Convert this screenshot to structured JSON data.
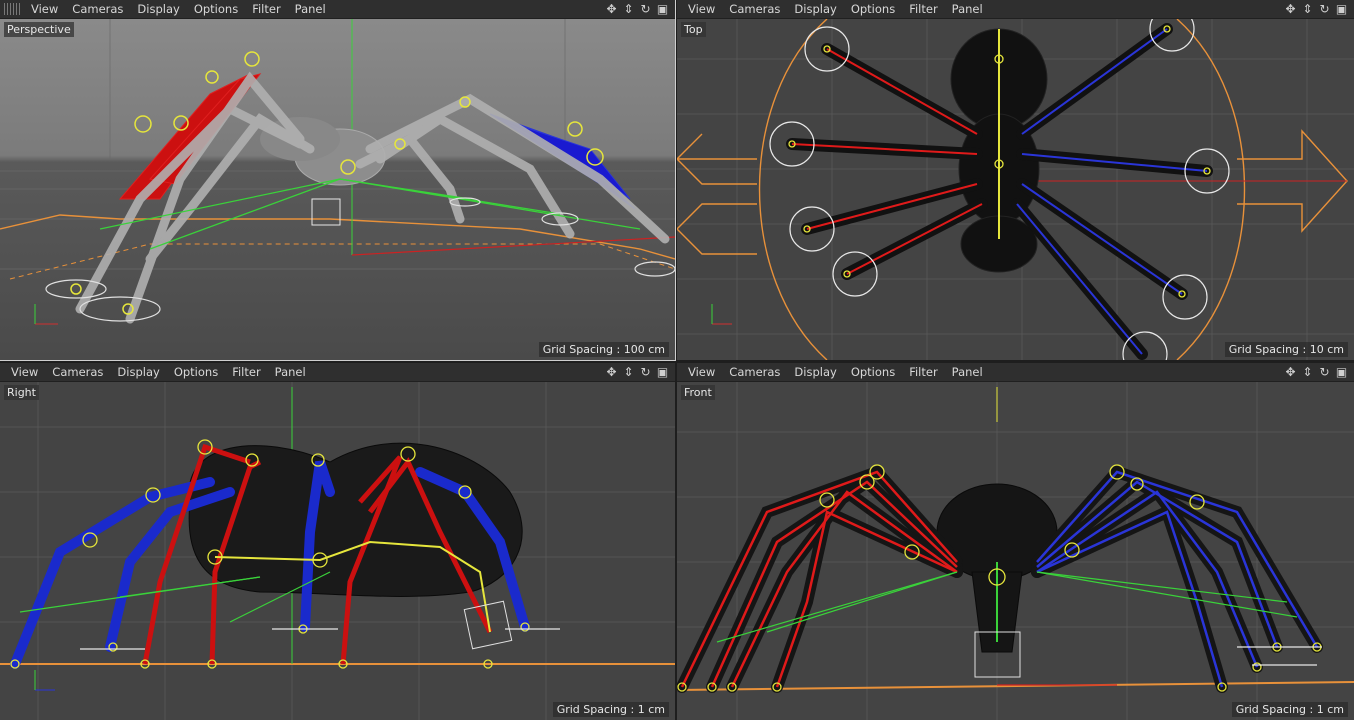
{
  "menu": {
    "items": [
      "View",
      "Cameras",
      "Display",
      "Options",
      "Filter",
      "Panel"
    ]
  },
  "nav_icons": [
    "move-view-icon",
    "dolly-view-icon",
    "rotate-view-icon",
    "toggle-panel-icon"
  ],
  "viewports": {
    "perspective": {
      "camera": "Perspective",
      "grid_spacing": "Grid Spacing : 100 cm"
    },
    "top": {
      "camera": "Top",
      "grid_spacing": "Grid Spacing : 10 cm"
    },
    "right": {
      "camera": "Right",
      "grid_spacing": "Grid Spacing : 1 cm"
    },
    "front": {
      "camera": "Front",
      "grid_spacing": "Grid Spacing : 1 cm"
    }
  },
  "colors": {
    "left_legs": "#e01a1a",
    "right_legs": "#2a35d8",
    "ik_lines": "#3ad23a",
    "joints": "#e6e63c",
    "controller": "#e8913a"
  }
}
